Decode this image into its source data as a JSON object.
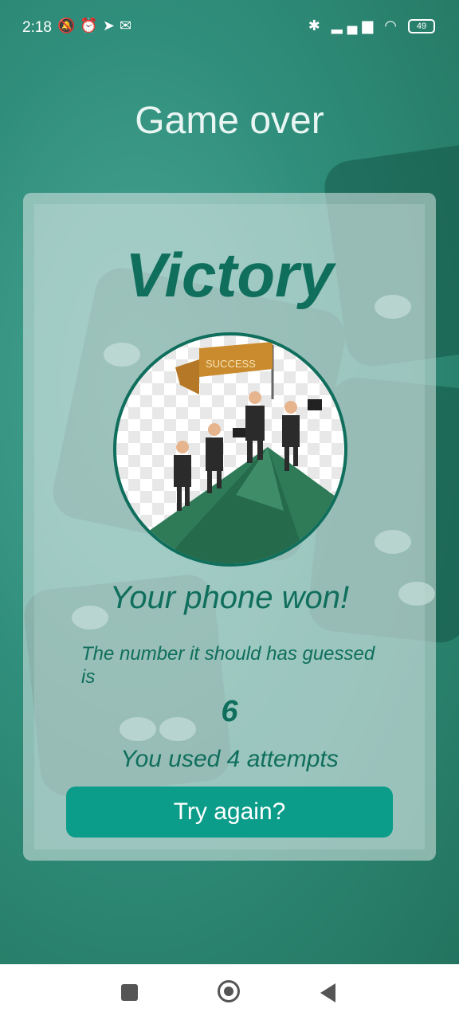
{
  "status_bar": {
    "time": "2:18",
    "battery": "49",
    "icons_left": [
      "mute-icon",
      "alarm-icon",
      "telegram-icon",
      "mail-icon"
    ],
    "icons_right": [
      "bluetooth-icon",
      "signal-icon",
      "wifi-icon",
      "battery-icon"
    ]
  },
  "screen": {
    "title": "Game over"
  },
  "result": {
    "heading": "Victory",
    "image_banner_text": "SUCCESS",
    "message": "Your phone won!",
    "guess_label": "The number it should has guessed is",
    "number": "6",
    "attempts_text": "You used 4 attempts",
    "try_again_label": "Try again?"
  },
  "colors": {
    "accent": "#0f6e5c",
    "button": "#0c9c8a",
    "background": "#2a8a78"
  },
  "nav_bar": {
    "icons": [
      "recents-icon",
      "home-icon",
      "back-icon"
    ]
  }
}
